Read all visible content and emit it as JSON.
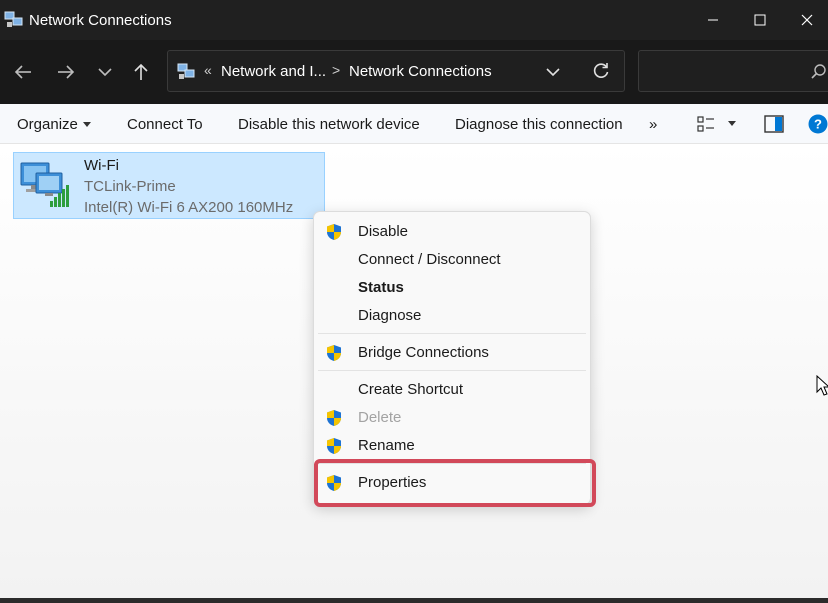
{
  "window": {
    "title": "Network Connections"
  },
  "address_bar": {
    "overflow_chevron": "«",
    "crumbs": [
      "Network and I...",
      "Network Connections"
    ],
    "separator": ">"
  },
  "toolbar": {
    "organize": "Organize",
    "connect_to": "Connect To",
    "disable_device": "Disable this network device",
    "diagnose": "Diagnose this connection",
    "more": "»"
  },
  "connection": {
    "name": "Wi-Fi",
    "network": "TCLink-Prime",
    "adapter": "Intel(R) Wi-Fi 6 AX200 160MHz"
  },
  "context_menu": {
    "items": [
      {
        "label": "Disable",
        "shield": true
      },
      {
        "label": "Connect / Disconnect",
        "shield": false
      },
      {
        "label": "Status",
        "shield": false,
        "bold": true
      },
      {
        "label": "Diagnose",
        "shield": false
      },
      {
        "label": "Bridge Connections",
        "shield": true
      },
      {
        "label": "Create Shortcut",
        "shield": false
      },
      {
        "label": "Delete",
        "shield": true,
        "disabled": true
      },
      {
        "label": "Rename",
        "shield": true
      },
      {
        "label": "Properties",
        "shield": true,
        "highlighted": true
      }
    ]
  },
  "colors": {
    "titlebar_bg": "#202020",
    "selection_bg": "#cce8ff",
    "highlight_border": "#d2495a",
    "help_blue": "#0078d4"
  }
}
